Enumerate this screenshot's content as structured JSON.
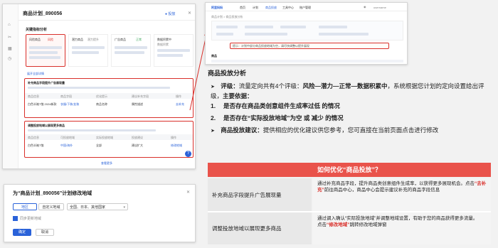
{
  "left_window": {
    "title": "商品计划_890056",
    "header_right": "● 投放",
    "section_title": "关键指标分析",
    "cards": [
      {
        "title": "风险商品",
        "value": "39",
        "badge": "风险"
      },
      {
        "title": "潜力商品",
        "value": "潜力提升",
        "badge": ""
      },
      {
        "title": "广告商品",
        "value": "正常",
        "badge": ""
      },
      {
        "title": "数据积累中",
        "value": "数据积累",
        "badge": ""
      }
    ],
    "expand_link": "展开全部详情",
    "table1": {
      "title": "补充商品字段提升广告展现量",
      "columns": [
        "商品信息",
        "商品字段",
        "优化提示",
        "建议补充字段",
        "操作"
      ],
      "row": [
        "白色半袖T恤 2024新款",
        "衣服/下装/女装",
        "商品名称",
        "属性描述",
        "去补充"
      ]
    },
    "table2": {
      "title": "调整投放地域以展现更多商品",
      "columns": [
        "商品信息",
        "可投放地域",
        "实际投放地域",
        "投放建议",
        "操作"
      ],
      "row": [
        "白色半袖T恤",
        "中国/海外",
        "全部",
        "建议扩大",
        "修改地域"
      ]
    },
    "footer_link": "查看更多"
  },
  "dialog": {
    "title": "为“商品计划_890056”计划修改地域",
    "tabs": [
      "地区",
      "自定义地域"
    ],
    "select_value": "全国、日本、其他国家",
    "checkbox_label": "同步更新地域",
    "ok": "确定",
    "cancel": "取消"
  },
  "right_window": {
    "brand": "阿里妈妈",
    "nav": [
      "首页",
      "计划",
      "商品投放",
      "工具中心",
      "账户管理"
    ],
    "user": "username",
    "breadcrumb": "商品计划 > 商品投放分析",
    "alert": "提示：计划中部分商品投放地域为空，请尽快调整以提升展现",
    "section": "商品"
  },
  "explain": {
    "title": "商品投放分析",
    "bullet1_label": "评级：",
    "bullet1_a": "流量定向共有4个评级：",
    "bullet1_b": "风险—潜力—正常—数据积累中",
    "bullet1_c": "，系统根据您计划的定向设置给出评级，",
    "bullet1_d": "主要依据：",
    "n1_num": "1.",
    "n1_text": "是否存在商品类创意组件生成率过低 的情况",
    "n2_num": "2.",
    "n2_text": "是否存在“实际投放地域”为空 或 减少 的情况",
    "bullet2_label": "商品投放建议：",
    "bullet2_text": "提供相应的优化建议供您参考，您可直接在当前页面点击进行修改"
  },
  "question": "如何优化“商品投放”？",
  "table": [
    {
      "label": "补充商品字段提升广告展现量",
      "desc_a": "通过补充商品字段，提升商品类创意组件生成率，以获得更多展现机会。",
      "desc_b": "点击",
      "desc_red": "“去补充”",
      "desc_c": "前往商品中心，商品中心会提示建议补充的商品字段信息"
    },
    {
      "label": "调整投放地域以展现更多商品",
      "desc_a": "通过调入确认“实际投放地域”并调整地域设置，有助于您的商品获得更多流量。",
      "desc_b": "点击",
      "desc_red": "“修改地域”",
      "desc_c": "跳转修改地域弹窗"
    }
  ],
  "colors": {
    "accent_red": "#d9302b",
    "banner": "#e9534b",
    "blue": "#2a62d9"
  }
}
